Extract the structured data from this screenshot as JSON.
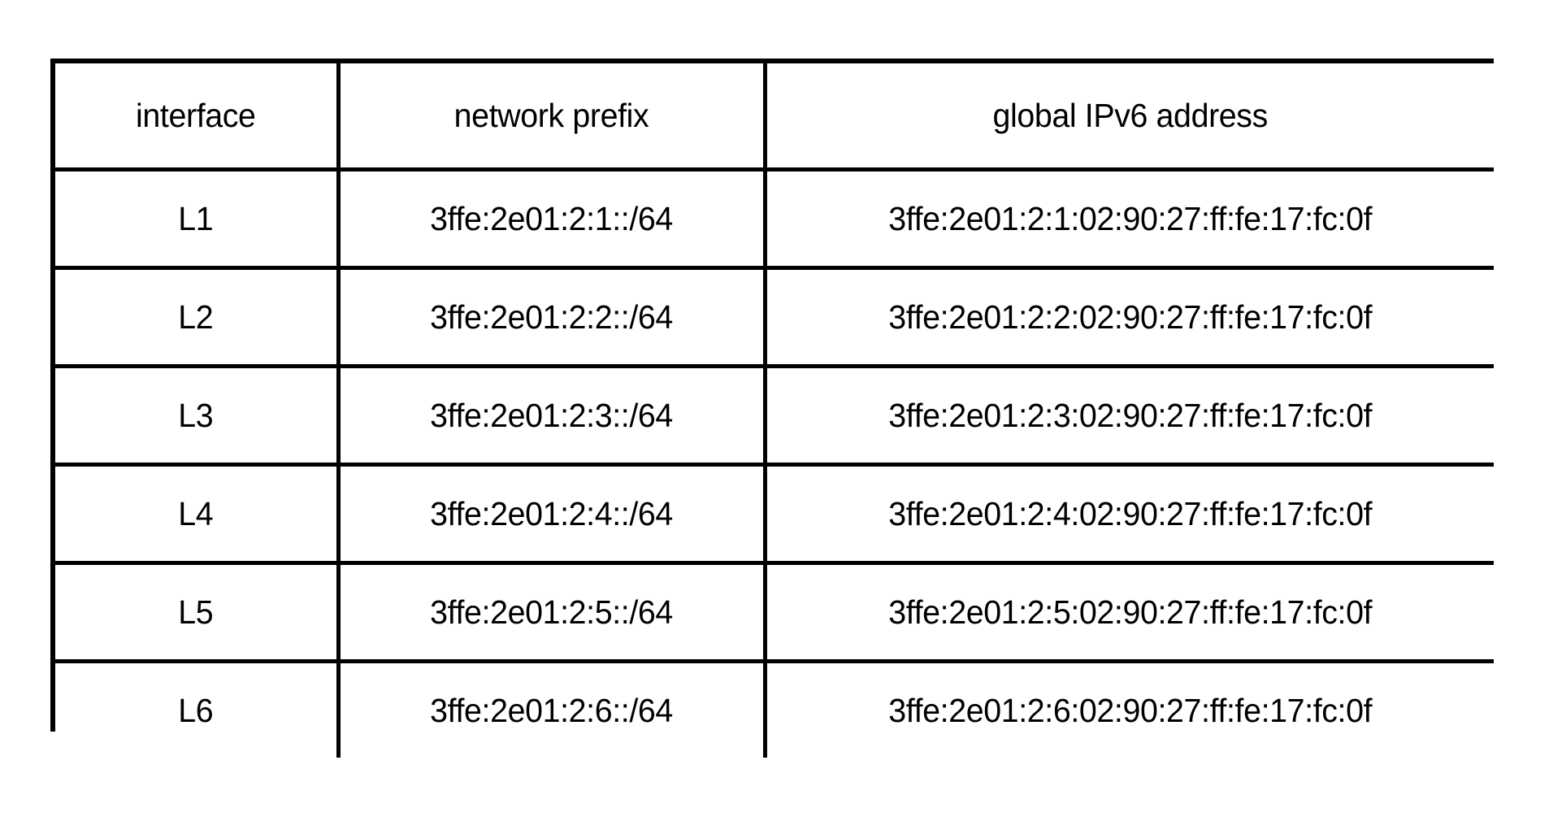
{
  "figure": {
    "kind": "table-figure",
    "background_color": "#ffffff",
    "ink_color": "#000000"
  },
  "table": {
    "columns": [
      {
        "key": "interface",
        "header": "interface"
      },
      {
        "key": "prefix",
        "header": "network prefix"
      },
      {
        "key": "address",
        "header": "global IPv6 address"
      }
    ],
    "rows": [
      {
        "interface": "L1",
        "prefix": "3ffe:2e01:2:1::/64",
        "address": "3ffe:2e01:2:1:02:90:27:ff:fe:17:fc:0f"
      },
      {
        "interface": "L2",
        "prefix": "3ffe:2e01:2:2::/64",
        "address": "3ffe:2e01:2:2:02:90:27:ff:fe:17:fc:0f"
      },
      {
        "interface": "L3",
        "prefix": "3ffe:2e01:2:3::/64",
        "address": "3ffe:2e01:2:3:02:90:27:ff:fe:17:fc:0f"
      },
      {
        "interface": "L4",
        "prefix": "3ffe:2e01:2:4::/64",
        "address": "3ffe:2e01:2:4:02:90:27:ff:fe:17:fc:0f"
      },
      {
        "interface": "L5",
        "prefix": "3ffe:2e01:2:5::/64",
        "address": "3ffe:2e01:2:5:02:90:27:ff:fe:17:fc:0f"
      },
      {
        "interface": "L6",
        "prefix": "3ffe:2e01:2:6::/64",
        "address": "3ffe:2e01:2:6:02:90:27:ff:fe:17:fc:0f"
      }
    ]
  }
}
